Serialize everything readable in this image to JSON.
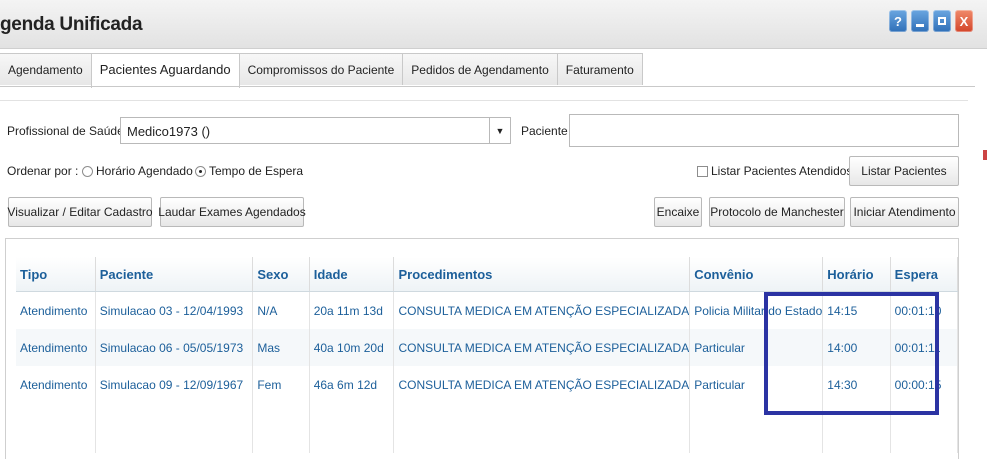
{
  "window": {
    "title": "genda Unificada",
    "buttons": {
      "help": "?",
      "close": "X"
    }
  },
  "tabs": [
    {
      "label": "Agendamento"
    },
    {
      "label": "Pacientes Aguardando"
    },
    {
      "label": "Compromissos do Paciente"
    },
    {
      "label": "Pedidos de Agendamento"
    },
    {
      "label": "Faturamento"
    }
  ],
  "filters": {
    "professional_label": "Profissional de Saúde",
    "professional_value": "Medico1973 ()",
    "patient_label": "Paciente",
    "patient_value": "",
    "order_label": "Ordenar por :",
    "order_options": [
      "Horário Agendado",
      "Tempo de Espera"
    ],
    "order_selected": "Tempo de Espera",
    "list_attended_label": "Listar Pacientes Atendidos"
  },
  "buttons": {
    "list_patients": "Listar Pacientes",
    "view_edit": "Visualizar / Editar Cadastro",
    "report_exams": "Laudar Exames Agendados",
    "fit_in": "Encaixe",
    "manchester": "Protocolo de Manchester",
    "start_service": "Iniciar Atendimento"
  },
  "table": {
    "headers": [
      "Tipo",
      "Paciente",
      "Sexo",
      "Idade",
      "Procedimentos",
      "Convênio",
      "Horário",
      "Espera"
    ],
    "rows": [
      [
        "Atendimento",
        "Simulacao 03 - 12/04/1993",
        "N/A",
        "20a 11m 13d",
        "CONSULTA MEDICA EM ATENÇÃO ESPECIALIZADA",
        "Policia Militar do Estado",
        "14:15",
        "00:01:10"
      ],
      [
        "Atendimento",
        "Simulacao 06 - 05/05/1973",
        "Mas",
        "40a 10m 20d",
        "CONSULTA MEDICA EM ATENÇÃO ESPECIALIZADA",
        "Particular",
        "14:00",
        "00:01:11"
      ],
      [
        "Atendimento",
        "Simulacao 09 - 12/09/1967",
        "Fem",
        "46a 6m 12d",
        "CONSULTA MEDICA EM ATENÇÃO ESPECIALIZADA",
        "Particular",
        "14:30",
        "00:00:15"
      ]
    ]
  },
  "colors": {
    "grid_text": "#1c5f9a",
    "highlight_border": "#2b33a3",
    "close_button": "#d3452a"
  }
}
